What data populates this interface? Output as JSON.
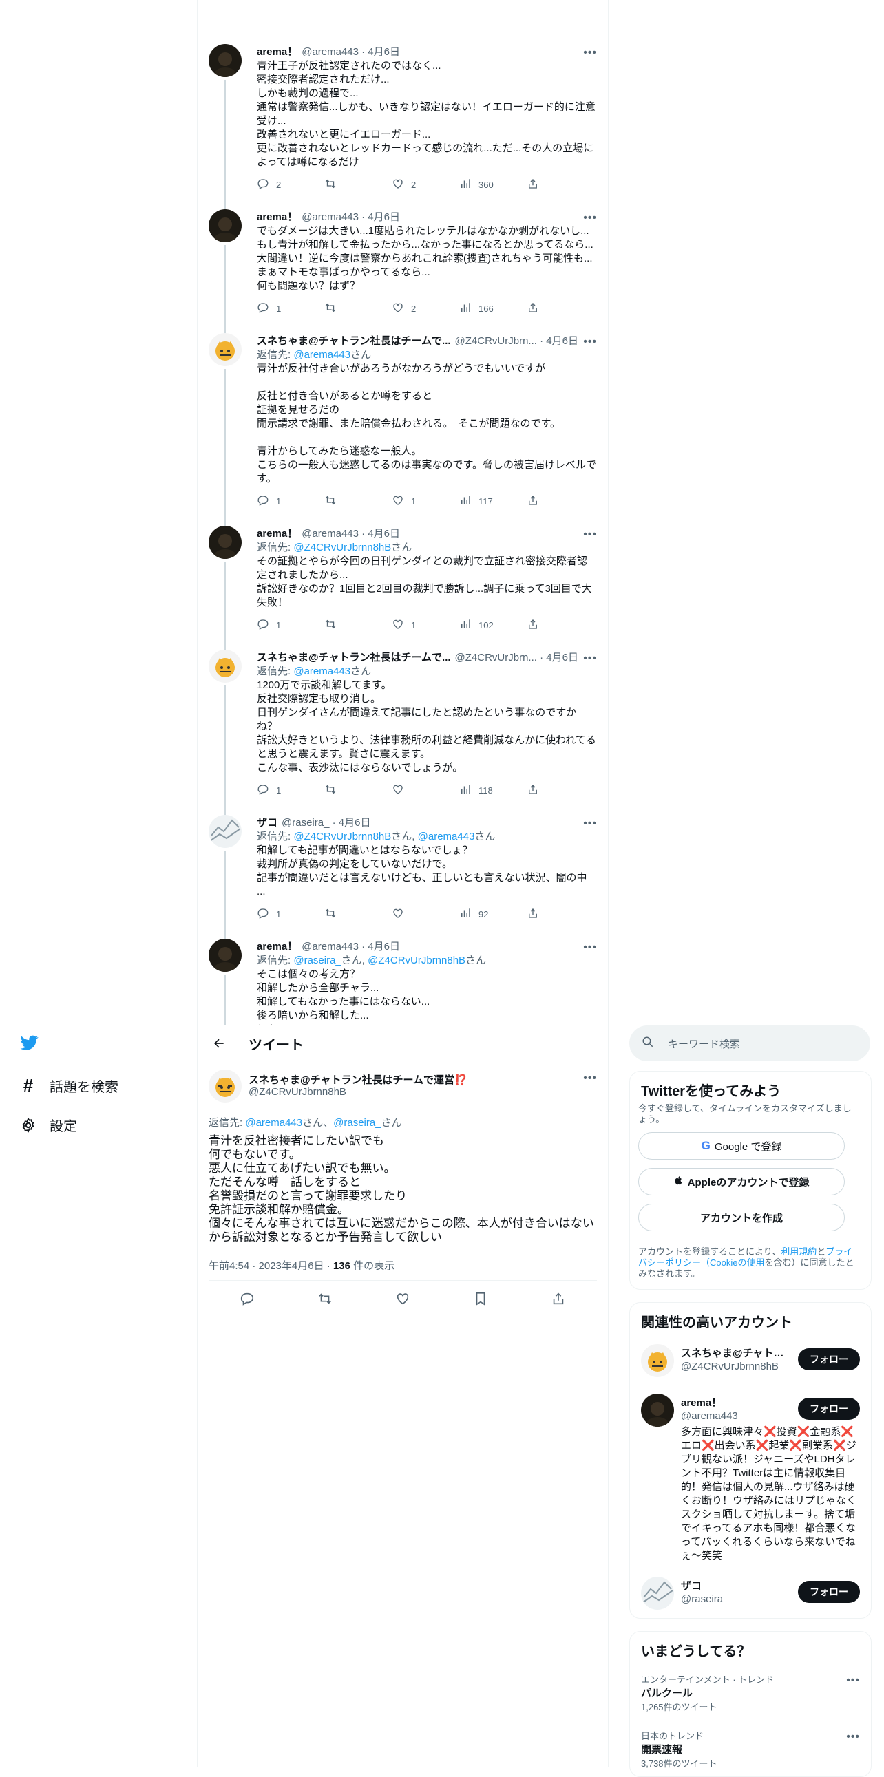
{
  "nav": {
    "search_label": "話題を検索",
    "settings_label": "設定"
  },
  "thread": [
    {
      "name": "arema！",
      "handle": "@arema443 · 4月6日",
      "avatar": "dark",
      "reply_to": null,
      "body": "青汁王子が反社認定されたのではなく...\n密接交際者認定されただけ...\nしかも裁判の過程で...\n通常は警察発信...しかも、いきなり認定はない！イエローガード的に注意受け...\n改善されないと更にイエローガード...\n更に改善されないとレッドカードって感じの流れ...ただ...その人の立場によっては噂になるだけ",
      "replies": "2",
      "retweets": "",
      "likes": "2",
      "views": "360"
    },
    {
      "name": "arema！",
      "handle": "@arema443 · 4月6日",
      "avatar": "dark",
      "reply_to": null,
      "body": "でもダメージは大きい...1度貼られたレッテルはなかなか剥がれないし...\nもし青汁が和解して金払ったから...なかった事になるとか思ってるなら...大間違い！逆に今度は警察からあれこれ詮索(捜査)されちゃう可能性も...\nまぁマトモな事ばっかやってるなら...\n何も問題ない？はず？",
      "replies": "1",
      "retweets": "",
      "likes": "2",
      "views": "166"
    },
    {
      "name": "スネちゃま@チャトラン社長はチームで...",
      "handle": "@Z4CRvUrJbrn... · 4月6日",
      "avatar": "cat",
      "reply_to": {
        "prefix": "返信先: ",
        "links": [
          "@arema443"
        ],
        "suffix": "さん"
      },
      "body": "青汁が反社付き合いがあろうがなかろうがどうでもいいですが\n\n反社と付き合いがあるとか噂をすると\n証拠を見せろだの\n開示請求で謝罪、また賠償金払わされる。　そこが問題なのです。\n\n青汁からしてみたら迷惑な一般人。\nこちらの一般人も迷惑してるのは事実なのです。脅しの被害届けレベルです。",
      "replies": "1",
      "retweets": "",
      "likes": "1",
      "views": "117"
    },
    {
      "name": "arema！",
      "handle": "@arema443 · 4月6日",
      "avatar": "dark",
      "reply_to": {
        "prefix": "返信先: ",
        "links": [
          "@Z4CRvUrJbrnn8hB"
        ],
        "suffix": "さん"
      },
      "body": "その証拠とやらが今回の日刊ゲンダイとの裁判で立証され密接交際者認定されましたから...\n訴訟好きなのか？1回目と2回目の裁判で勝訴し...調子に乗って3回目で大失敗！",
      "replies": "1",
      "retweets": "",
      "likes": "1",
      "views": "102"
    },
    {
      "name": "スネちゃま@チャトラン社長はチームで...",
      "handle": "@Z4CRvUrJbrn... · 4月6日",
      "avatar": "cat",
      "reply_to": {
        "prefix": "返信先: ",
        "links": [
          "@arema443"
        ],
        "suffix": "さん"
      },
      "body": "1200万で示談和解してます。\n反社交際認定も取り消し。\n日刊ゲンダイさんが間違えて記事にしたと認めたという事なのですかね？\n訴訟大好きというより、法律事務所の利益と経費削減なんかに使われてると思うと震えます。賢さに震えます。\nこんな事、表沙汰にはならないでしょうが。",
      "replies": "1",
      "retweets": "",
      "likes": "",
      "views": "118"
    },
    {
      "name": "ザコ",
      "handle": "@raseira_ · 4月6日",
      "avatar": "zako",
      "reply_to": {
        "prefix": "返信先: ",
        "links": [
          "@Z4CRvUrJbrnn8hB",
          "@arema443"
        ],
        "suffix": "さん"
      },
      "body": "和解しても記事が間違いとはならないでしょ？\n裁判所が真偽の判定をしていないだけで。\n記事が間違いだとは言えないけども、正しいとも言えない状況、闇の中 ...",
      "replies": "1",
      "retweets": "",
      "likes": "",
      "views": "92"
    },
    {
      "name": "arema！",
      "handle": "@arema443 · 4月6日",
      "avatar": "dark",
      "reply_to": {
        "prefix": "返信先: ",
        "links": [
          "@raseira_",
          "@Z4CRvUrJbrnn8hB"
        ],
        "suffix": "さん"
      },
      "body": "そこは個々の考え方？\n和解したから全部チャラ...\n和解してもなかった事にはならない...\n後ろ暗いから和解した...\nとか...\n色んな人がいて...色んな見方や考え方や意見があるのでは？ないでしょうか？",
      "replies": "",
      "retweets": "",
      "likes": "",
      "views": ""
    }
  ],
  "main_header": {
    "title": "ツイート"
  },
  "main_tweet": {
    "name": "スネちゃま@チャトラン社長はチームで運営",
    "name_emoji": "⁉️",
    "handle": "@Z4CRvUrJbrnn8hB",
    "reply_prefix": "返信先: ",
    "reply_link1": "@arema443",
    "reply_mid": "さん、",
    "reply_link2": "@raseira_",
    "reply_suffix": "さん",
    "body": "青汁を反社密接者にしたい訳でも\n何でもないです。\n悪人に仕立てあげたい訳でも無い。\nただそんな噂　話しをすると\n名誉毀損だのと言って謝罪要求したり\n免許証示談和解か賠償金。\n個々にそんな事されては互いに迷惑だからこの際、本人が付き合いはないから訴訟対象となるとか予告発言して欲しい",
    "time": "午前4:54 · 2023年4月6日 · ",
    "views_count": "136",
    "views_label": " 件の表示"
  },
  "sidebar": {
    "search_placeholder": "キーワード検索",
    "signup": {
      "title": "Twitterを使ってみよう",
      "subtitle": "今すぐ登録して、タイムラインをカスタマイズしましょう。",
      "google": "Google で登録",
      "apple": "Appleのアカウントで登録",
      "create": "アカウントを作成",
      "legal_1": "アカウントを登録することにより、",
      "legal_terms": "利用規約",
      "legal_2": "と",
      "legal_privacy": "プライバシーポリシー（Cookieの使用",
      "legal_3": "を含む）に同意したとみなされます。"
    },
    "related": {
      "title": "関連性の高いアカウント",
      "follow_label": "フォロー",
      "accounts": [
        {
          "name": "スネちゃま@チャトラン社長はチームで運営",
          "handle": "@Z4CRvUrJbrnn8hB",
          "bio": ""
        },
        {
          "name": "arema！",
          "handle": "@arema443",
          "bio": "多方面に興味津々❌投資❌金融系❌エロ❌出会い系❌起業❌副業系❌ジブリ観ない派！ジャニーズやLDHタレント不用？Twitterは主に情報収集目的！発信は個人の見解...ウザ絡みは硬くお断り！ウザ絡みにはリプじゃなくスクショ晒して対抗しまーす。捨て垢でイキってるアホも同様！都合悪くなってパッくれるくらいなら来ないでねぇ〜笑笑"
        },
        {
          "name": "ザコ",
          "handle": "@raseira_",
          "bio": ""
        }
      ]
    },
    "trends": {
      "title": "いまどうしてる？",
      "items": [
        {
          "category": "エンターテインメント · トレンド",
          "title": "パルクール",
          "count": "1,265件のツイート"
        },
        {
          "category": "日本のトレンド",
          "title": "開票速報",
          "count": "3,738件のツイート"
        }
      ]
    }
  },
  "colors": {
    "accent": "#1d9bf0",
    "text": "#0f1419",
    "muted": "#536471",
    "border": "#eff3f4"
  }
}
